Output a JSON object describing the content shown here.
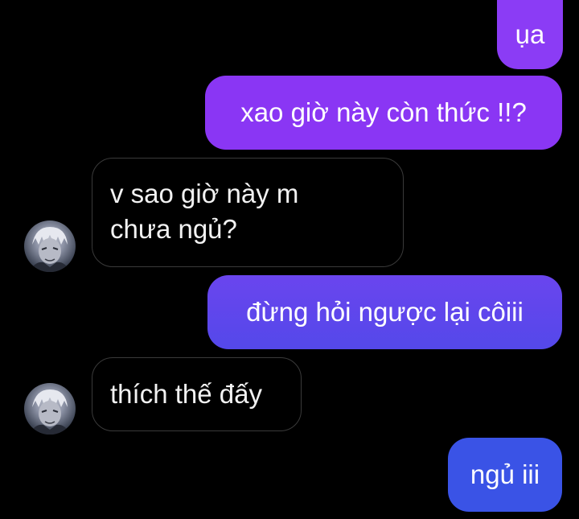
{
  "messages": [
    {
      "id": "m1",
      "direction": "sent",
      "text": "ụa"
    },
    {
      "id": "m2",
      "direction": "sent",
      "text": "xao giờ này còn thức !!?"
    },
    {
      "id": "m3",
      "direction": "received",
      "text": "v sao giờ này m\nchưa ngủ?"
    },
    {
      "id": "m4",
      "direction": "sent",
      "text": "đừng hỏi ngược lại côiii"
    },
    {
      "id": "m5",
      "direction": "received",
      "text": "thích thế đấy"
    },
    {
      "id": "m6",
      "direction": "sent",
      "text": "ngủ iii"
    }
  ],
  "colors": {
    "background": "#000000",
    "sent_gradient_top": "#8a3df3",
    "sent_gradient_bottom": "#3f52e6",
    "received_border": "#3a3a3a",
    "text": "#ffffff"
  },
  "icons": {
    "contact_avatar": "anime-portrait-avatar"
  }
}
